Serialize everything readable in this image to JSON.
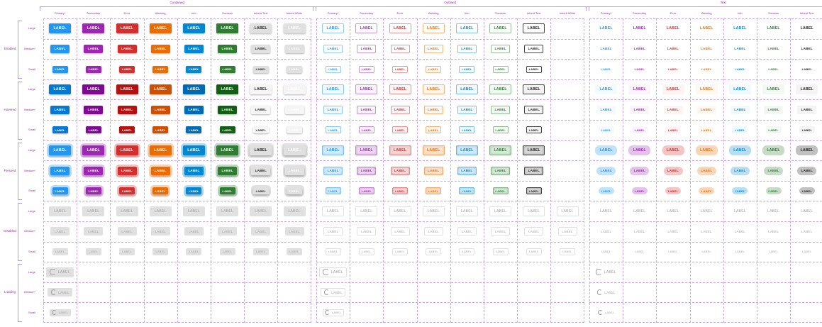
{
  "groups": [
    "Contained",
    "Outlined",
    "Text"
  ],
  "columns": [
    "Primary*",
    "Secondary",
    "Error",
    "Warning",
    "Info",
    "Success",
    "Inherit Text",
    "Inherit White"
  ],
  "states": [
    "Enabled",
    "Hovered",
    "Pressed",
    "Disabled",
    "Loading"
  ],
  "sizes": [
    "Large",
    "Medium*",
    "Small"
  ],
  "button_label": "LABEL",
  "colors": {
    "accent": "#9c27b0",
    "grid_line": "#c8a6e8",
    "primary": "#2196f3",
    "secondary": "#9c27b0",
    "error": "#d32f2f",
    "warning": "#ed6c02",
    "info": "#0288d1",
    "success": "#2e7d32",
    "inherit_text": "#212121",
    "inherit_white_bg": "#e0e0e0",
    "disabled_bg": "#e0e0e0",
    "disabled_text": "#a3a3a3"
  },
  "icons": [
    "loading-spinner-icon"
  ]
}
